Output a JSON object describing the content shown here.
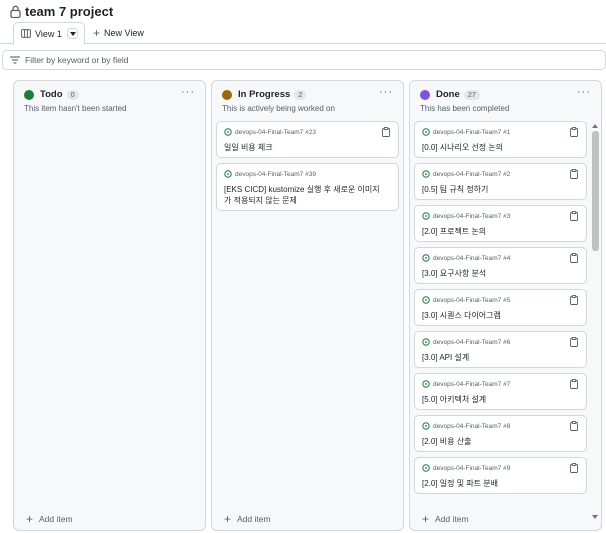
{
  "project": {
    "title": "team 7 project"
  },
  "views": {
    "active_tab": "View 1",
    "new_view_label": "New View"
  },
  "filter": {
    "placeholder": "Filter by keyword or by field"
  },
  "colors": {
    "todo": "#1a7f37",
    "in_progress": "#9a6700",
    "done": "#8250df",
    "issue_ring": "#1a7f37"
  },
  "columns": [
    {
      "name": "Todo",
      "count": "0",
      "description": "This item hasn't been started",
      "add_label": "Add item",
      "cards": []
    },
    {
      "name": "In Progress",
      "count": "2",
      "description": "This is actively being worked on",
      "add_label": "Add item",
      "cards": [
        {
          "repo": "devops-04-Final-Team7 #23",
          "title": "일일 비용 체크"
        },
        {
          "repo": "devops-04-Final-Team7 #39",
          "title": "[EKS CICD] kustomize 실행 후 새로운 이미지가 적용되지 않는 문제"
        }
      ]
    },
    {
      "name": "Done",
      "count": "27",
      "description": "This has been completed",
      "add_label": "Add item",
      "cards": [
        {
          "repo": "devops-04-Final-Team7 #1",
          "title": "[0.0] 시나리오 선정 논의"
        },
        {
          "repo": "devops-04-Final-Team7 #2",
          "title": "[0.5] 팀 규칙 정하기"
        },
        {
          "repo": "devops-04-Final-Team7 #3",
          "title": "[2.0] 프로젝트 논의"
        },
        {
          "repo": "devops-04-Final-Team7 #4",
          "title": "[3.0] 요구사항 분석"
        },
        {
          "repo": "devops-04-Final-Team7 #5",
          "title": "[3.0] 시퀀스 다이어그램"
        },
        {
          "repo": "devops-04-Final-Team7 #6",
          "title": "[3.0] API 설계"
        },
        {
          "repo": "devops-04-Final-Team7 #7",
          "title": "[5.0] 아키텍처 설계"
        },
        {
          "repo": "devops-04-Final-Team7 #8",
          "title": "[2.0] 비용 산출"
        },
        {
          "repo": "devops-04-Final-Team7 #9",
          "title": "[2.0] 일정 및 파트 분배"
        }
      ]
    }
  ]
}
